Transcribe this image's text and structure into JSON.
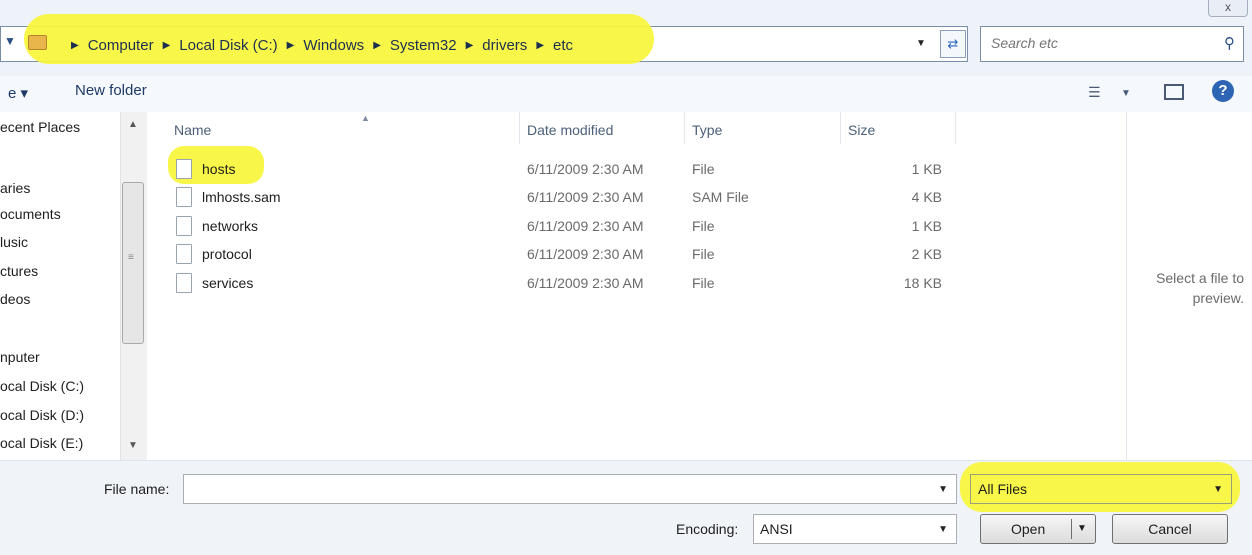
{
  "window": {
    "close_glyph": "x"
  },
  "address_bar": {
    "breadcrumbs": [
      "Computer",
      "Local Disk (C:)",
      "Windows",
      "System32",
      "drivers",
      "etc"
    ],
    "search_placeholder": "Search etc"
  },
  "toolbar": {
    "organize_label": "e ▾",
    "new_folder_label": "New folder"
  },
  "nav_pane": {
    "items": [
      {
        "label": "ecent Places"
      },
      {
        "label": "aries"
      },
      {
        "label": "ocuments"
      },
      {
        "label": "lusic"
      },
      {
        "label": "ctures"
      },
      {
        "label": "deos"
      },
      {
        "label": "nputer"
      },
      {
        "label": "ocal Disk (C:)"
      },
      {
        "label": "ocal Disk (D:)"
      },
      {
        "label": "ocal Disk (E:)"
      }
    ]
  },
  "file_list": {
    "columns": [
      "Name",
      "Date modified",
      "Type",
      "Size"
    ],
    "rows": [
      {
        "name": "hosts",
        "date": "6/11/2009 2:30 AM",
        "type": "File",
        "size": "1 KB"
      },
      {
        "name": "lmhosts.sam",
        "date": "6/11/2009 2:30 AM",
        "type": "SAM File",
        "size": "4 KB"
      },
      {
        "name": "networks",
        "date": "6/11/2009 2:30 AM",
        "type": "File",
        "size": "1 KB"
      },
      {
        "name": "protocol",
        "date": "6/11/2009 2:30 AM",
        "type": "File",
        "size": "2 KB"
      },
      {
        "name": "services",
        "date": "6/11/2009 2:30 AM",
        "type": "File",
        "size": "18 KB"
      }
    ]
  },
  "preview": {
    "line1": "Select a file to",
    "line2": "preview."
  },
  "bottom": {
    "file_name_label": "File name:",
    "file_name_value": "",
    "file_type_filter": "All Files",
    "encoding_label": "Encoding:",
    "encoding_value": "ANSI",
    "open_label": "Open",
    "cancel_label": "Cancel"
  },
  "colors": {
    "highlight": "#f7f63a",
    "accent": "#2e64b4"
  }
}
